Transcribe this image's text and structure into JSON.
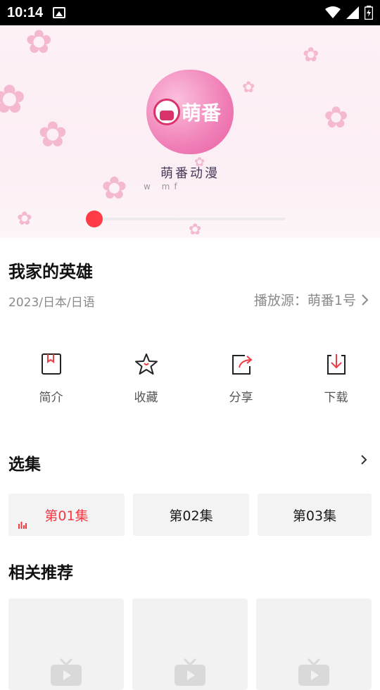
{
  "status_bar": {
    "time": "10:14"
  },
  "player": {
    "brand_logo_text": "萌番",
    "brand_name": "萌番动漫",
    "brand_url": "w   mf",
    "progress_fraction": 0.02
  },
  "video": {
    "title": "我家的英雄",
    "meta": "2023/日本/日语",
    "source_label": "播放源：萌番1号"
  },
  "actions": [
    {
      "label": "简介",
      "icon": "bookmark-icon"
    },
    {
      "label": "收藏",
      "icon": "star-icon"
    },
    {
      "label": "分享",
      "icon": "share-icon"
    },
    {
      "label": "下载",
      "icon": "download-icon"
    }
  ],
  "episodes_section": {
    "title": "选集",
    "items": [
      {
        "label": "第01集",
        "active": true
      },
      {
        "label": "第02集",
        "active": false
      },
      {
        "label": "第03集",
        "active": false
      }
    ]
  },
  "recommend_section": {
    "title": "相关推荐"
  },
  "colors": {
    "accent": "#f03a44",
    "brand_pink": "#f07fb7"
  }
}
